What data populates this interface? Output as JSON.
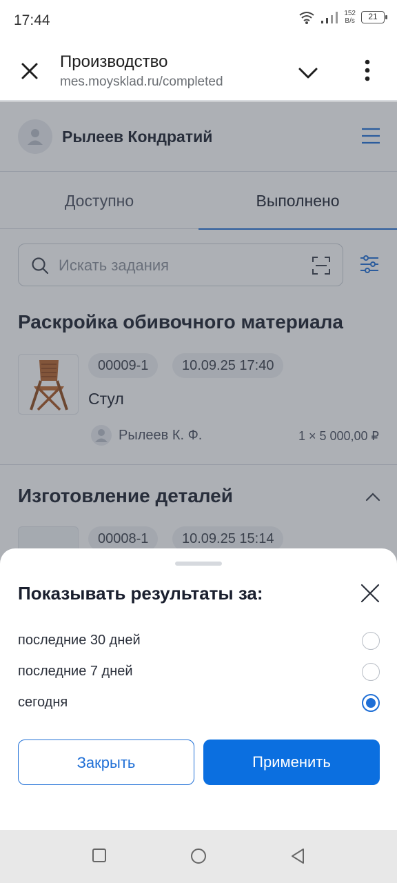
{
  "status_bar": {
    "time": "17:44",
    "net_speed_value": "152",
    "net_speed_unit": "B/s",
    "battery": "21"
  },
  "browser": {
    "title": "Производство",
    "url": "mes.moysklad.ru/completed"
  },
  "user": {
    "name": "Рылеев Кондратий"
  },
  "tabs": [
    {
      "label": "Доступно",
      "active": false
    },
    {
      "label": "Выполнено",
      "active": true
    }
  ],
  "search": {
    "placeholder": "Искать задания"
  },
  "sections": [
    {
      "title": "Раскройка обивочного материала",
      "task": {
        "id": "00009-1",
        "datetime": "10.09.25 17:40",
        "product": "Стул",
        "worker": "Рылеев К. Ф.",
        "price": "1 × 5 000,00 ₽"
      }
    },
    {
      "title": "Изготовление деталей",
      "task": {
        "id": "00008-1",
        "datetime": "10.09.25 15:14"
      }
    }
  ],
  "sheet": {
    "title": "Показывать результаты за:",
    "options": [
      {
        "label": "последние 30 дней",
        "selected": false
      },
      {
        "label": "последние 7 дней",
        "selected": false
      },
      {
        "label": "сегодня",
        "selected": true
      }
    ],
    "close_label": "Закрыть",
    "apply_label": "Применить"
  },
  "colors": {
    "accent": "#0b6fe0",
    "text": "#1a1f2e",
    "overlay": "rgba(60,66,78,0.42)"
  }
}
